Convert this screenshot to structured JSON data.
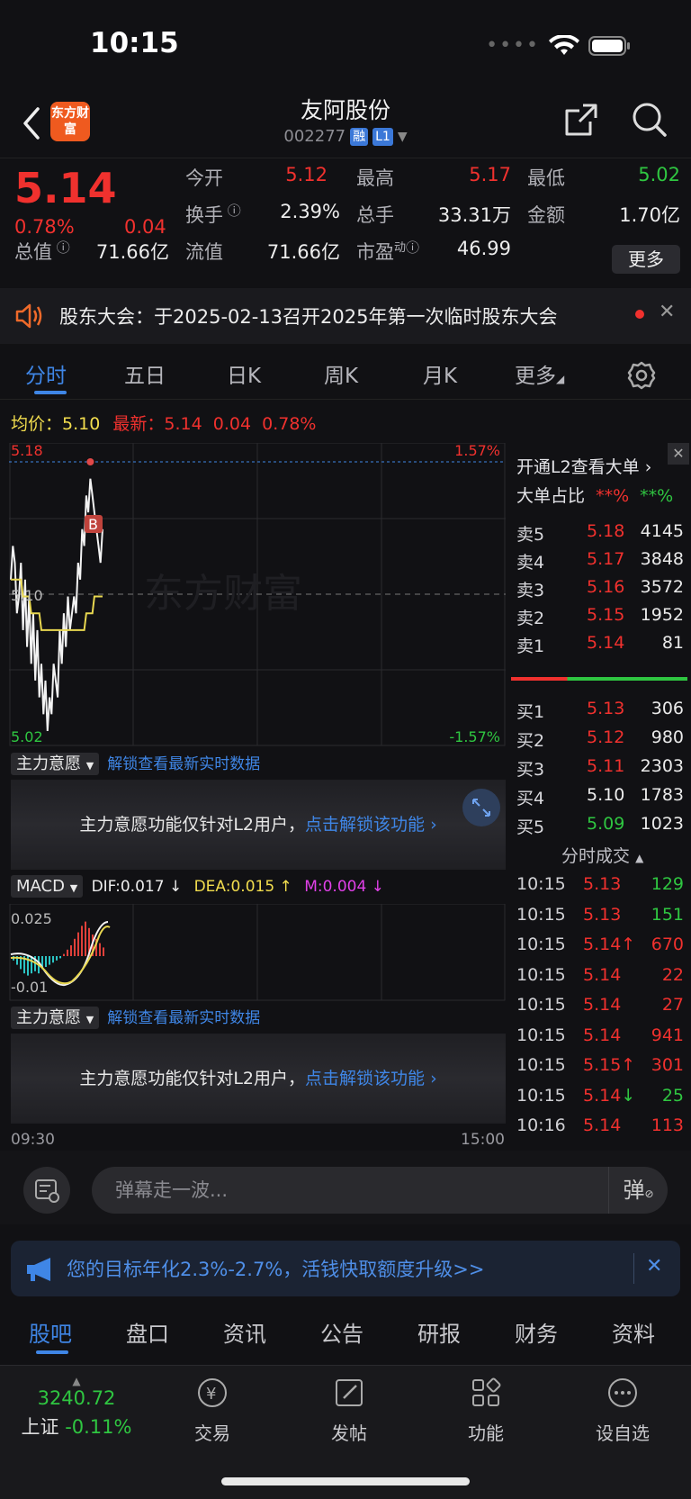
{
  "status": {
    "time": "10:15"
  },
  "nav": {
    "logo_text": "东方财富",
    "title": "友阿股份",
    "code": "002277",
    "tag1": "融",
    "tag2": "L1"
  },
  "quote": {
    "price": "5.14",
    "pct": "0.78%",
    "change": "0.04",
    "open_label": "今开",
    "open": "5.12",
    "high_label": "最高",
    "high": "5.17",
    "low_label": "最低",
    "low": "5.02",
    "turnover_label": "换手",
    "turnover": "2.39%",
    "volume_label": "总手",
    "volume": "33.31万",
    "amount_label": "金额",
    "amount": "1.70亿",
    "mcap_label": "总值",
    "mcap": "71.66亿",
    "float_label": "流值",
    "float": "71.66亿",
    "pe_label": "市盈",
    "pe_sup": "动",
    "pe": "46.99",
    "more": "更多"
  },
  "notice": {
    "text": "股东大会：于2025-02-13召开2025年第一次临时股东大会"
  },
  "tabs": [
    "分时",
    "五日",
    "日K",
    "周K",
    "月K",
    "更多"
  ],
  "avg": {
    "label": "均价：",
    "value": "5.10",
    "latest_label": "最新：",
    "latest": "5.14",
    "chg": "0.04",
    "pct": "0.78%"
  },
  "chart": {
    "y_top": "5.18",
    "y_mid": "5.10",
    "y_bottom": "5.02",
    "pct_top": "1.57%",
    "pct_bottom": "-1.57%",
    "watermark": "东方财富",
    "marker": "B",
    "x_start": "09:30",
    "x_end": "15:00"
  },
  "chart_data": {
    "type": "line",
    "x": [
      "09:30",
      "09:31",
      "09:32",
      "09:33",
      "09:34",
      "09:35",
      "09:36",
      "09:37",
      "09:38",
      "09:39",
      "09:40",
      "09:41",
      "09:42",
      "09:43",
      "09:44",
      "09:45",
      "09:46",
      "09:47",
      "09:48",
      "09:49",
      "09:50",
      "09:51",
      "09:52",
      "09:53",
      "09:54",
      "09:55",
      "09:56",
      "09:57",
      "09:58",
      "09:59",
      "10:00",
      "10:01",
      "10:02",
      "10:03",
      "10:04",
      "10:05",
      "10:06",
      "10:07",
      "10:08",
      "10:09",
      "10:10",
      "10:11",
      "10:12",
      "10:13",
      "10:14",
      "10:15"
    ],
    "series": [
      {
        "values": [
          5.11,
          5.13,
          5.12,
          5.09,
          5.1,
          5.12,
          5.08,
          5.11,
          5.07,
          5.1,
          5.06,
          5.09,
          5.05,
          5.08,
          5.04,
          5.06,
          5.03,
          5.05,
          5.02,
          5.04,
          5.03,
          5.06,
          5.05,
          5.04,
          5.08,
          5.06,
          5.09,
          5.07,
          5.1,
          5.08,
          5.09,
          5.1,
          5.09,
          5.12,
          5.11,
          5.14,
          5.13,
          5.16,
          5.15,
          5.17,
          5.16,
          5.15,
          5.14,
          5.13,
          5.12,
          5.14
        ]
      },
      {
        "values": [
          5.11,
          5.11,
          5.11,
          5.11,
          5.11,
          5.11,
          5.1,
          5.1,
          5.1,
          5.1,
          5.09,
          5.09,
          5.09,
          5.09,
          5.09,
          5.08,
          5.08,
          5.08,
          5.08,
          5.08,
          5.08,
          5.08,
          5.08,
          5.08,
          5.08,
          5.08,
          5.08,
          5.08,
          5.08,
          5.08,
          5.08,
          5.08,
          5.08,
          5.08,
          5.08,
          5.08,
          5.08,
          5.09,
          5.09,
          5.09,
          5.09,
          5.1,
          5.1,
          5.1,
          5.1,
          5.1
        ]
      }
    ],
    "ylim": [
      5.02,
      5.18
    ]
  },
  "macd": {
    "name": "MACD",
    "dif": "DIF:0.017 ↓",
    "dea": "DEA:0.015 ↑",
    "m": "M:0.004 ↓",
    "y_top": "0.025",
    "y_bottom": "-0.01",
    "bars": [
      -0.002,
      -0.004,
      -0.006,
      -0.008,
      -0.009,
      -0.008,
      -0.007,
      -0.008,
      -0.006,
      -0.005,
      -0.004,
      -0.003,
      -0.002,
      -0.001,
      0.001,
      0.003,
      0.005,
      0.008,
      0.011,
      0.014,
      0.016,
      0.013,
      0.01,
      0.008,
      0.006,
      0.004
    ]
  },
  "intent": {
    "label": "主力意愿",
    "unlock_link": "解锁查看最新实时数据",
    "lock_text": "主力意愿功能仅针对L2用户，",
    "lock_link": "点击解锁该功能"
  },
  "book": {
    "l2_text": "开通L2查看大单",
    "big_label": "大单占比",
    "big_buy": "**%",
    "big_sell": "**%",
    "asks": [
      {
        "label": "卖5",
        "price": "5.18",
        "vol": "4145"
      },
      {
        "label": "卖4",
        "price": "5.17",
        "vol": "3848"
      },
      {
        "label": "卖3",
        "price": "5.16",
        "vol": "3572"
      },
      {
        "label": "卖2",
        "price": "5.15",
        "vol": "1952"
      },
      {
        "label": "卖1",
        "price": "5.14",
        "vol": "81"
      }
    ],
    "bids": [
      {
        "label": "买1",
        "price": "5.13",
        "vol": "306"
      },
      {
        "label": "买2",
        "price": "5.12",
        "vol": "980"
      },
      {
        "label": "买3",
        "price": "5.11",
        "vol": "2303"
      },
      {
        "label": "买4",
        "price": "5.10",
        "vol": "1783"
      },
      {
        "label": "买5",
        "price": "5.09",
        "vol": "1023"
      }
    ],
    "ticks_label": "分时成交",
    "ticks": [
      {
        "time": "10:15",
        "price": "5.13",
        "vol": "129"
      },
      {
        "time": "10:15",
        "price": "5.13",
        "vol": "151"
      },
      {
        "time": "10:15",
        "price": "5.14↑",
        "vol": "670"
      },
      {
        "time": "10:15",
        "price": "5.14",
        "vol": "22"
      },
      {
        "time": "10:15",
        "price": "5.14",
        "vol": "27"
      },
      {
        "time": "10:15",
        "price": "5.14",
        "vol": "941"
      },
      {
        "time": "10:15",
        "price": "5.15↑",
        "vol": "301"
      },
      {
        "time": "10:15",
        "price": "5.14↓",
        "vol": "25"
      },
      {
        "time": "10:16",
        "price": "5.14",
        "vol": "113"
      }
    ]
  },
  "comment": {
    "placeholder": "弹幕走一波...",
    "danmu_btn": "弹"
  },
  "ad": {
    "text": "您的目标年化2.3%-2.7%，活钱快取额度升级>>"
  },
  "subtabs": [
    "股吧",
    "盘口",
    "资讯",
    "公告",
    "研报",
    "财务",
    "资料"
  ],
  "tabbar": {
    "index_value": "3240.72",
    "index_name": "上证",
    "index_pct": "-0.11%",
    "trade": "交易",
    "post": "发帖",
    "func": "功能",
    "watch": "设自选"
  }
}
